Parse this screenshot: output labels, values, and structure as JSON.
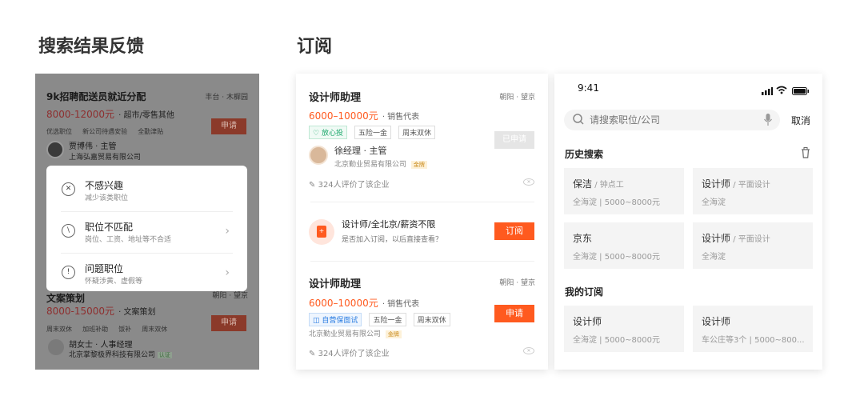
{
  "sections": {
    "left_title": "搜索结果反馈",
    "right_title": "订阅"
  },
  "panel1": {
    "job1": {
      "title": "9k招聘配送员就近分配",
      "location": "丰台 · 木樨园",
      "salary": "8000-12000元",
      "category": "· 超市/零售其他",
      "tags": [
        "优选职位",
        "新公司待遇安验",
        "全勤津贴"
      ],
      "apply": "申请",
      "contact": "贾博伟 · 主管",
      "company": "上海弘嘉贸易有限公司"
    },
    "menu": [
      {
        "title": "不感兴趣",
        "sub": "减少该类职位",
        "icon": "✕"
      },
      {
        "title": "职位不匹配",
        "sub": "岗位、工资、地址等不合适",
        "icon": "\\"
      },
      {
        "title": "问题职位",
        "sub": "怀疑涉黄、虚假等",
        "icon": "!"
      }
    ],
    "job2": {
      "title": "文案策划",
      "location": "朝阳 · 望京",
      "salary": "8000-15000元",
      "category": "· 文案策划",
      "tags": [
        "周末双休",
        "加班补助",
        "饭补",
        "周末双休"
      ],
      "apply": "申请",
      "contact": "胡女士 · 人事经理",
      "company": "北京掌黎极界科技有限公司",
      "badge": "认证"
    }
  },
  "panel2": {
    "job1": {
      "title": "设计师助理",
      "location": "朝阳 · 望京",
      "salary": "6000–10000元",
      "category": "· 销售代表",
      "badge": "放心投",
      "tags": [
        "五险一金",
        "周末双休"
      ],
      "apply_disabled": "已申请",
      "contact": "徐经理 · 主管",
      "company": "北京勤业贸易有限公司",
      "gold": "金牌",
      "reviews": "324人评价了该企业"
    },
    "subscribe": {
      "title": "设计师/全北京/薪资不限",
      "sub": "是否加入订阅，以后直接查看？",
      "button": "订阅"
    },
    "job2": {
      "title": "设计师助理",
      "location": "朝阳 · 望京",
      "salary": "6000–10000元",
      "category": "· 销售代表",
      "badge": "自营保面试",
      "tags": [
        "五险一金",
        "周末双休"
      ],
      "apply": "申请",
      "company": "北京勤业贸易有限公司",
      "gold": "金牌",
      "reviews": "324人评价了该企业"
    }
  },
  "panel3": {
    "time": "9:41",
    "search_placeholder": "请搜索职位/公司",
    "cancel": "取消",
    "history_title": "历史搜索",
    "history": [
      {
        "main": "保洁",
        "sub": " / 钟点工",
        "detail": "全海淀 | 5000~8000元"
      },
      {
        "main": "设计师",
        "sub": " / 平面设计",
        "detail": "全海淀"
      },
      {
        "main": "京东",
        "sub": "",
        "detail": "全海淀 | 5000~8000元"
      },
      {
        "main": "设计师",
        "sub": " / 平面设计",
        "detail": "全海淀"
      }
    ],
    "subs_title": "我的订阅",
    "subscriptions": [
      {
        "main": "设计师",
        "detail": "全海淀 | 5000~8000元"
      },
      {
        "main": "设计师",
        "detail": "车公庄等3个 | 5000~800..."
      }
    ]
  },
  "colors": {
    "accent": "#ff5a1f",
    "overlay": "#8a8a8a"
  }
}
